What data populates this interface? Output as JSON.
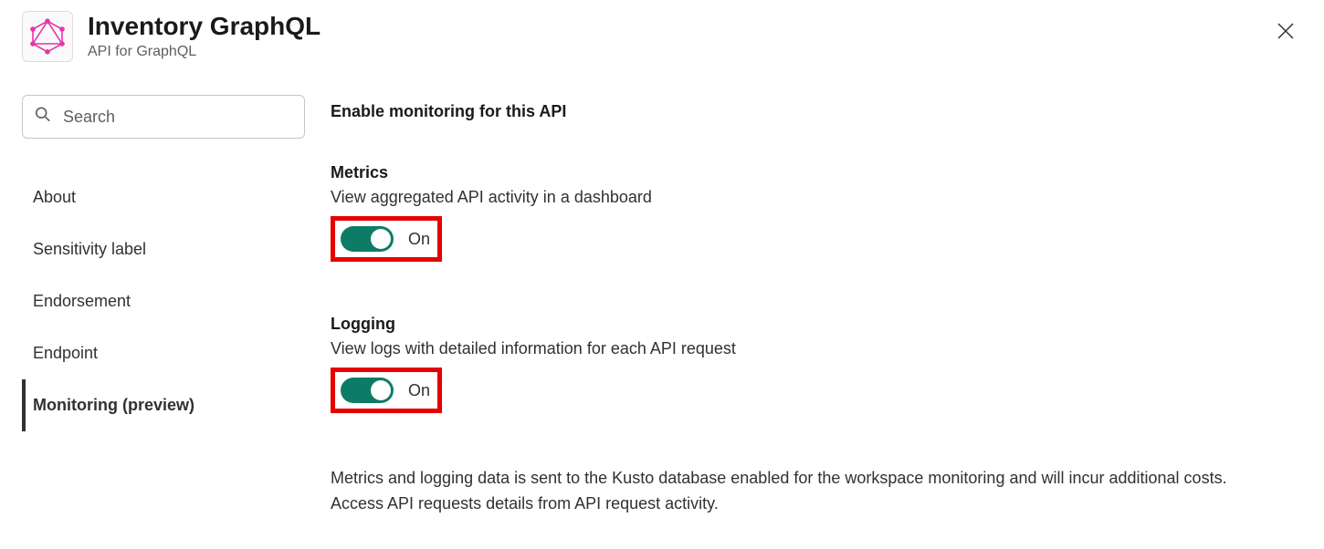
{
  "header": {
    "title": "Inventory GraphQL",
    "subtitle": "API for GraphQL"
  },
  "search": {
    "placeholder": "Search",
    "value": ""
  },
  "nav": {
    "items": [
      {
        "label": "About",
        "active": false
      },
      {
        "label": "Sensitivity label",
        "active": false
      },
      {
        "label": "Endorsement",
        "active": false
      },
      {
        "label": "Endpoint",
        "active": false
      },
      {
        "label": "Monitoring (preview)",
        "active": true
      }
    ]
  },
  "main": {
    "heading": "Enable monitoring for this API",
    "metrics": {
      "title": "Metrics",
      "description": "View aggregated API activity in a dashboard",
      "state_label": "On",
      "on": true
    },
    "logging": {
      "title": "Logging",
      "description": "View logs with detailed information for each API request",
      "state_label": "On",
      "on": true
    },
    "footnote": "Metrics and logging data is sent to the Kusto database enabled for the workspace monitoring and will incur additional costs. Access API requests details from API request activity."
  }
}
